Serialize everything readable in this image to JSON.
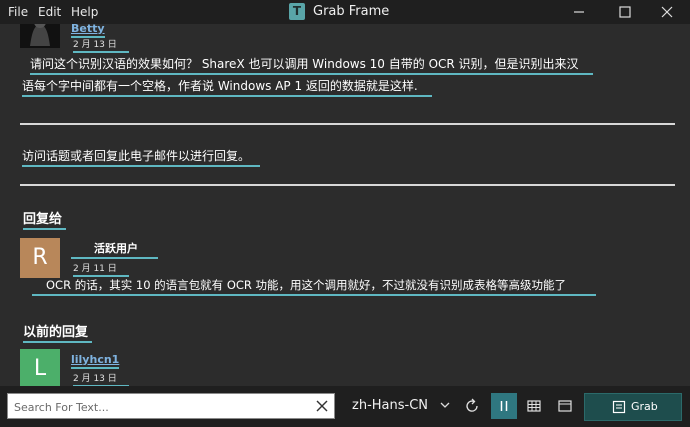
{
  "window": {
    "title": "Grab Frame",
    "app_icon_letter": "T",
    "menu": [
      "File",
      "Edit",
      "Help"
    ]
  },
  "posts": {
    "first": {
      "username": "Betty",
      "date": "2 月 13 日",
      "body_line1": "请问这个识别汉语的效果如何？ ShareX 也可以调用 Windows 10 自带的 OCR 识别，但是识别出来汉",
      "body_line2": "语每个字中间都有一个空格，作者说 Windows AP 1 返回的数据就是这样."
    },
    "visit_text": "访问话题或者回复此电子邮件以进行回复。",
    "reply_to_heading": "回复给",
    "reply_to": {
      "avatar_letter": "R",
      "avatar_color": "#b8875a",
      "username": "活跃用户",
      "date": "2 月 11 日",
      "body": "OCR 的话，其实 10 的语言包就有 OCR 功能，用这个调用就好，不过就没有识别成表格等高级功能了"
    },
    "previous_heading": "以前的回复",
    "previous": {
      "avatar_letter": "L",
      "avatar_color": "#4caf6a",
      "username": "lilyhcn1",
      "date": "2 月 13 日"
    }
  },
  "toolbar": {
    "search_placeholder": "Search For Text...",
    "language": "zh-Hans-CN",
    "grab_label": "Grab",
    "accent": "#5fb8c2"
  }
}
